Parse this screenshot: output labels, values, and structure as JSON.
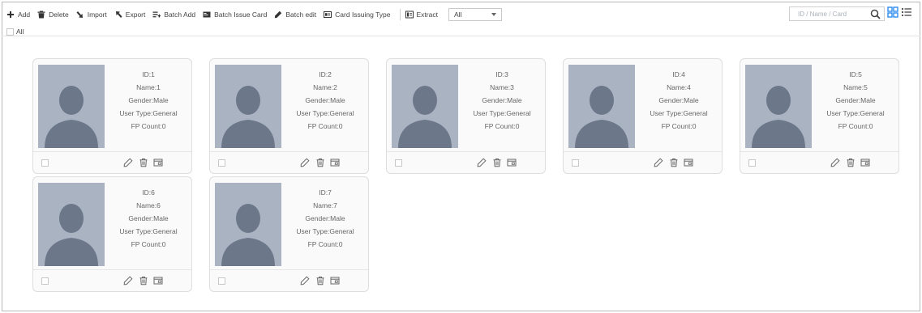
{
  "toolbar": {
    "add": "Add",
    "delete": "Delete",
    "import": "Import",
    "export": "Export",
    "batch_add": "Batch Add",
    "batch_issue_card": "Batch Issue Card",
    "batch_edit": "Batch edit",
    "card_issuing_type": "Card Issuing Type",
    "extract": "Extract",
    "extract_value": "All"
  },
  "search": {
    "placeholder": "ID / Name / Card"
  },
  "select_all_label": "All",
  "colors": {
    "photo_bg": "#aab3c2",
    "silhouette": "#6d778a",
    "accent_blue": "#2d8cf0"
  },
  "cards": [
    {
      "id": "ID:1",
      "name": "Name:1",
      "gender": "Gender:Male",
      "user_type": "User Type:General",
      "fp_count": "FP Count:0"
    },
    {
      "id": "ID:2",
      "name": "Name:2",
      "gender": "Gender:Male",
      "user_type": "User Type:General",
      "fp_count": "FP Count:0"
    },
    {
      "id": "ID:3",
      "name": "Name:3",
      "gender": "Gender:Male",
      "user_type": "User Type:General",
      "fp_count": "FP Count:0"
    },
    {
      "id": "ID:4",
      "name": "Name:4",
      "gender": "Gender:Male",
      "user_type": "User Type:General",
      "fp_count": "FP Count:0"
    },
    {
      "id": "ID:5",
      "name": "Name:5",
      "gender": "Gender:Male",
      "user_type": "User Type:General",
      "fp_count": "FP Count:0"
    },
    {
      "id": "ID:6",
      "name": "Name:6",
      "gender": "Gender:Male",
      "user_type": "User Type:General",
      "fp_count": "FP Count:0"
    },
    {
      "id": "ID:7",
      "name": "Name:7",
      "gender": "Gender:Male",
      "user_type": "User Type:General",
      "fp_count": "FP Count:0"
    }
  ]
}
